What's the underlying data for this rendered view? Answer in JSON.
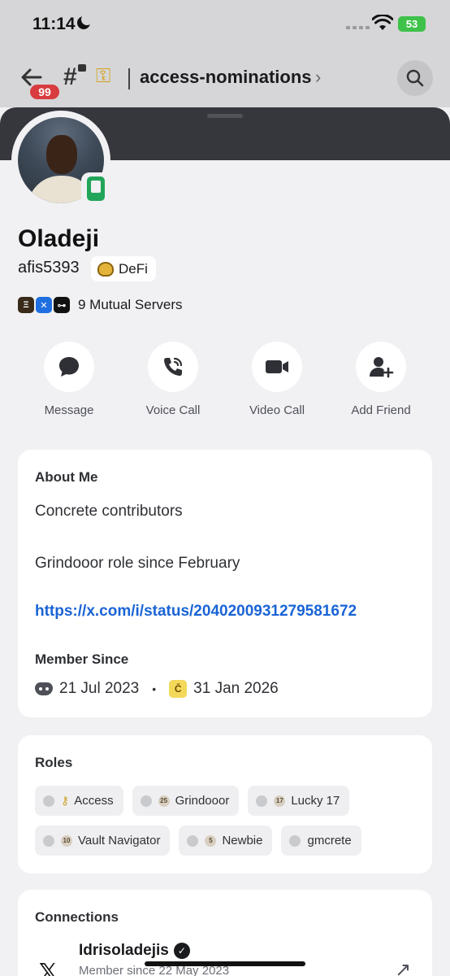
{
  "status_bar": {
    "time": "11:14",
    "battery": "53"
  },
  "header": {
    "unread_badge": "99",
    "channel_name": "access-nominations"
  },
  "profile": {
    "display_name": "Oladeji",
    "username": "afis5393",
    "server_tag": "DeFi",
    "mutual_servers": "9 Mutual Servers"
  },
  "actions": [
    {
      "label": "Message",
      "icon": "chat-bubble-icon"
    },
    {
      "label": "Voice Call",
      "icon": "phone-icon"
    },
    {
      "label": "Video Call",
      "icon": "video-camera-icon"
    },
    {
      "label": "Add Friend",
      "icon": "add-friend-icon"
    }
  ],
  "about": {
    "heading": "About Me",
    "line1": "Concrete contributors",
    "line2": "Grindooor role since February",
    "link": "https://x.com/i/status/2040200931279581672",
    "member_since_heading": "Member Since",
    "discord_date": "21 Jul 2023",
    "server_date": "31 Jan 2026"
  },
  "roles": {
    "heading": "Roles",
    "items": [
      {
        "label": "Access",
        "icon": "key-icon"
      },
      {
        "label": "Grindooor",
        "icon": "25"
      },
      {
        "label": "Lucky 17",
        "icon": "17"
      },
      {
        "label": "Vault Navigator",
        "icon": "10"
      },
      {
        "label": "Newbie",
        "icon": "5"
      },
      {
        "label": "gmcrete",
        "icon": ""
      }
    ]
  },
  "connections": {
    "heading": "Connections",
    "name": "Idrisoladejis",
    "sub": "Member since 22 May 2023"
  },
  "colors": {
    "accent_link": "#1a64d6",
    "online_green": "#23a55a",
    "badge_red": "#d83c3e"
  }
}
